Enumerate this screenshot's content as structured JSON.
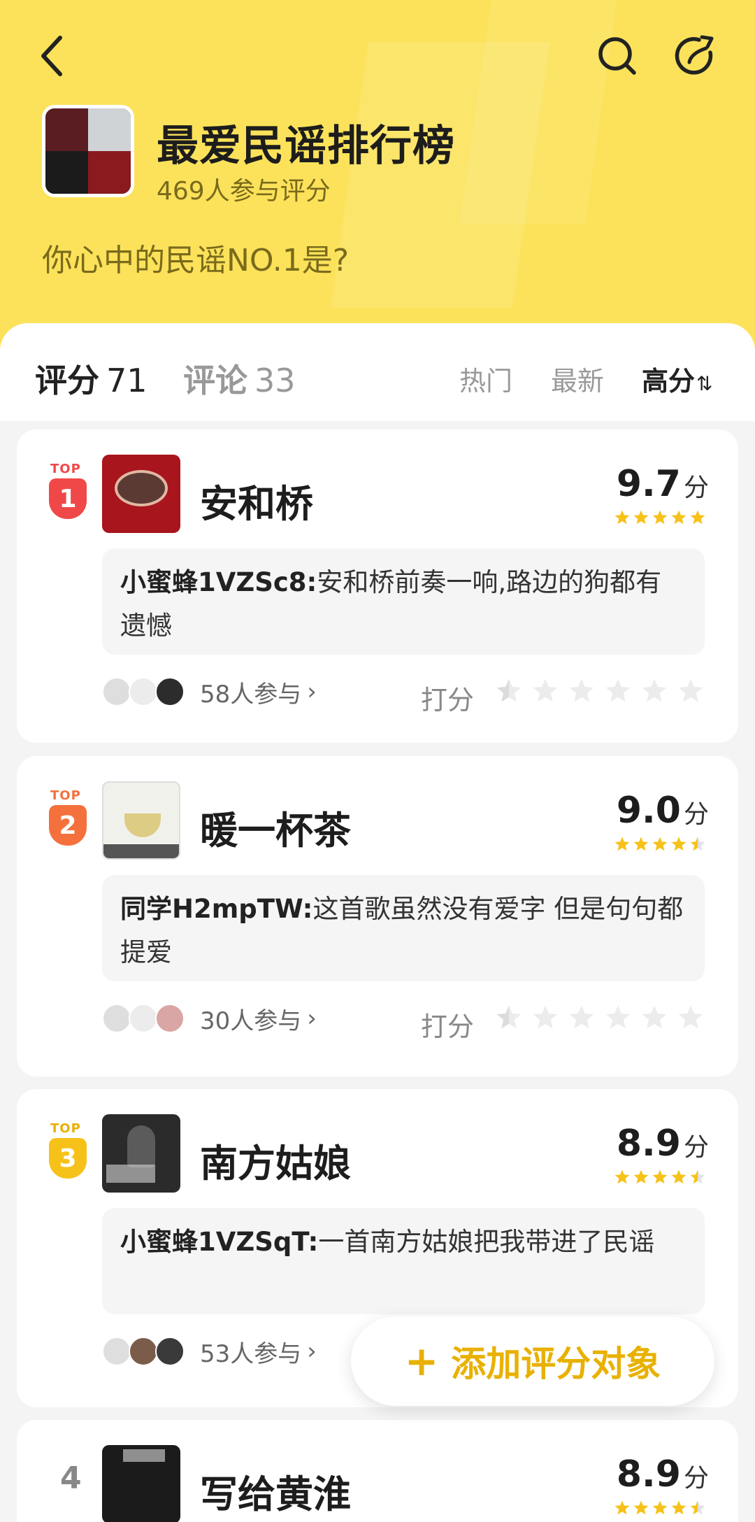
{
  "header": {
    "title": "最爱民谣排行榜",
    "participants": "469人参与评分",
    "question": "你心中的民谣NO.1是?"
  },
  "tabs": {
    "rating_label": "评分",
    "rating_count": "71",
    "comments_label": "评论",
    "comments_count": "33"
  },
  "sort": {
    "hot": "热门",
    "newest": "最新",
    "high": "高分",
    "high_arrow": "⇅"
  },
  "top_label": "TOP",
  "score_unit": "分",
  "rate_label": "打分",
  "items": [
    {
      "rank": "1",
      "name": "安和桥",
      "score": "9.7",
      "rating_stars": 5,
      "comment_user": "小蜜蜂1VZSc8:",
      "comment_text": "安和桥前奏一响,路边的狗都有遗憾",
      "participants": "58人参与",
      "arrow": "›"
    },
    {
      "rank": "2",
      "name": "暖一杯茶",
      "score": "9.0",
      "rating_stars": 4.5,
      "comment_user": "同学H2mpTW:",
      "comment_text": "这首歌虽然没有爱字 但是句句都提爱",
      "participants": "30人参与",
      "arrow": "›"
    },
    {
      "rank": "3",
      "name": "南方姑娘",
      "score": "8.9",
      "rating_stars": 4.5,
      "comment_user": "小蜜蜂1VZSqT:",
      "comment_text": "一首南方姑娘把我带进了民谣",
      "participants": "53人参与",
      "arrow": "›"
    },
    {
      "rank": "4",
      "name": "写给黄淮",
      "score": "8.9",
      "rating_stars": 4.5
    }
  ],
  "fab": {
    "plus": "+",
    "label": "添加评分对象"
  },
  "colors": {
    "hero_bg": "#fbe25a",
    "rank1": "#f04848",
    "rank2": "#f4703c",
    "rank3": "#f6c21a",
    "star_gold": "#f6c21a",
    "accent": "#e8b100"
  },
  "icons": {
    "back": "chevron-left-icon",
    "search": "search-icon",
    "share": "share-icon",
    "star": "star-icon"
  }
}
